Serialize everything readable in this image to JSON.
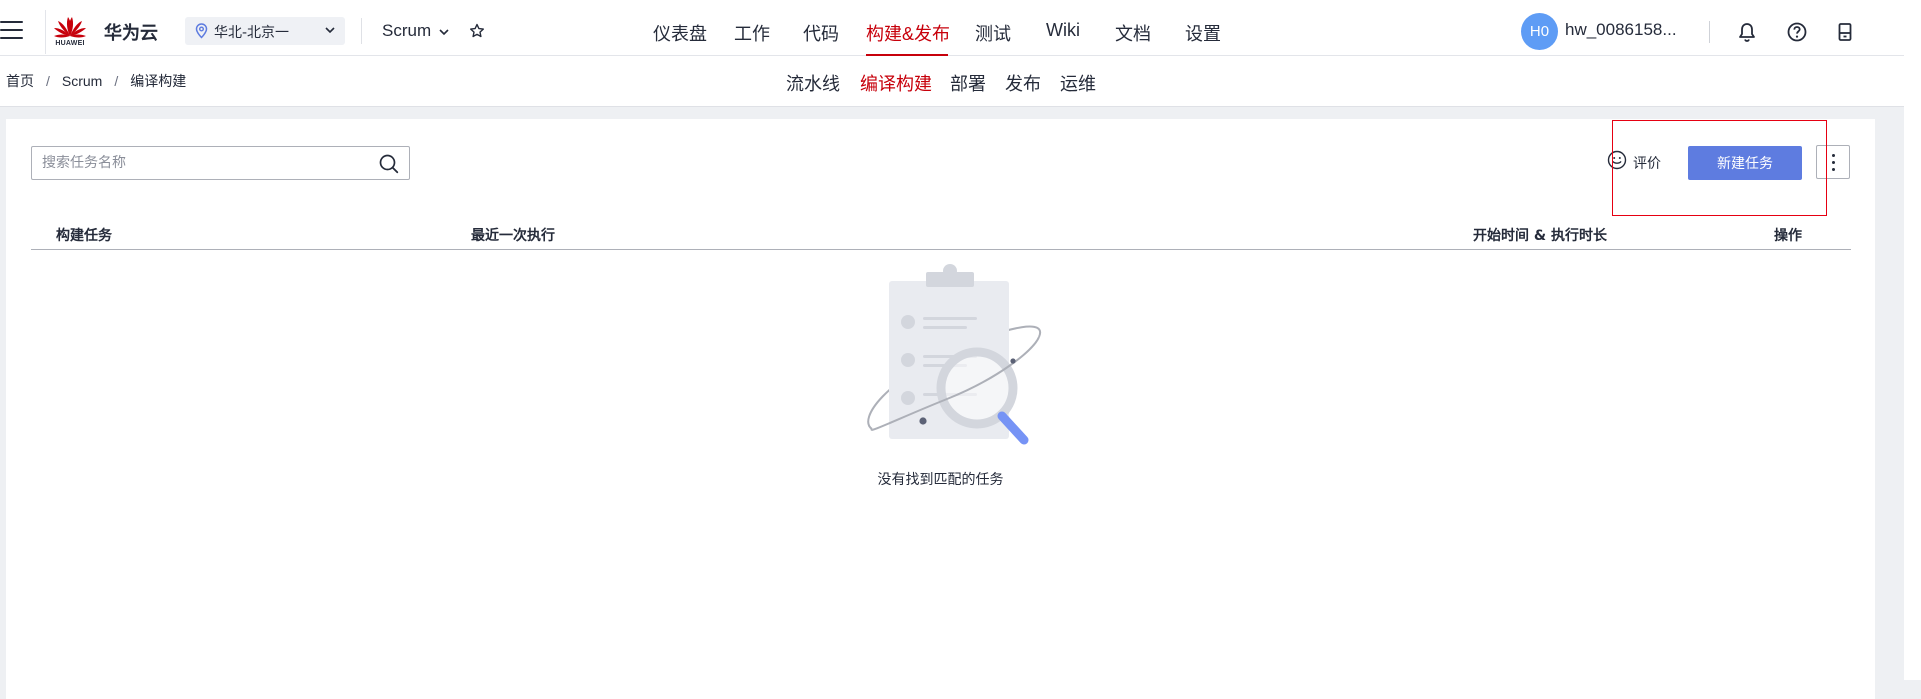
{
  "header": {
    "brand": "华为云",
    "logo_text": "HUAWEI",
    "region": "华北-北京一",
    "project": "Scrum",
    "nav": [
      {
        "label": "仪表盘",
        "active": false
      },
      {
        "label": "工作",
        "active": false
      },
      {
        "label": "代码",
        "active": false
      },
      {
        "label": "构建&发布",
        "active": true
      },
      {
        "label": "测试",
        "active": false
      },
      {
        "label": "Wiki",
        "active": false
      },
      {
        "label": "文档",
        "active": false
      },
      {
        "label": "设置",
        "active": false
      }
    ],
    "avatar_initials": "H0",
    "username": "hw_0086158..."
  },
  "breadcrumb": [
    "首页",
    "Scrum",
    "编译构建"
  ],
  "subnav": [
    {
      "label": "流水线",
      "active": false
    },
    {
      "label": "编译构建",
      "active": true
    },
    {
      "label": "部署",
      "active": false
    },
    {
      "label": "发布",
      "active": false
    },
    {
      "label": "运维",
      "active": false
    }
  ],
  "toolbar": {
    "search_placeholder": "搜索任务名称",
    "rate_label": "评价",
    "new_task_label": "新建任务"
  },
  "table": {
    "columns": [
      "构建任务",
      "最近一次执行",
      "开始时间 & 执行时长",
      "操作"
    ],
    "empty_text": "没有找到匹配的任务"
  },
  "colors": {
    "brand_red": "#c7000b",
    "primary_button": "#5e7ce0",
    "avatar": "#5e9cf5",
    "highlight_box": "#e60012"
  }
}
